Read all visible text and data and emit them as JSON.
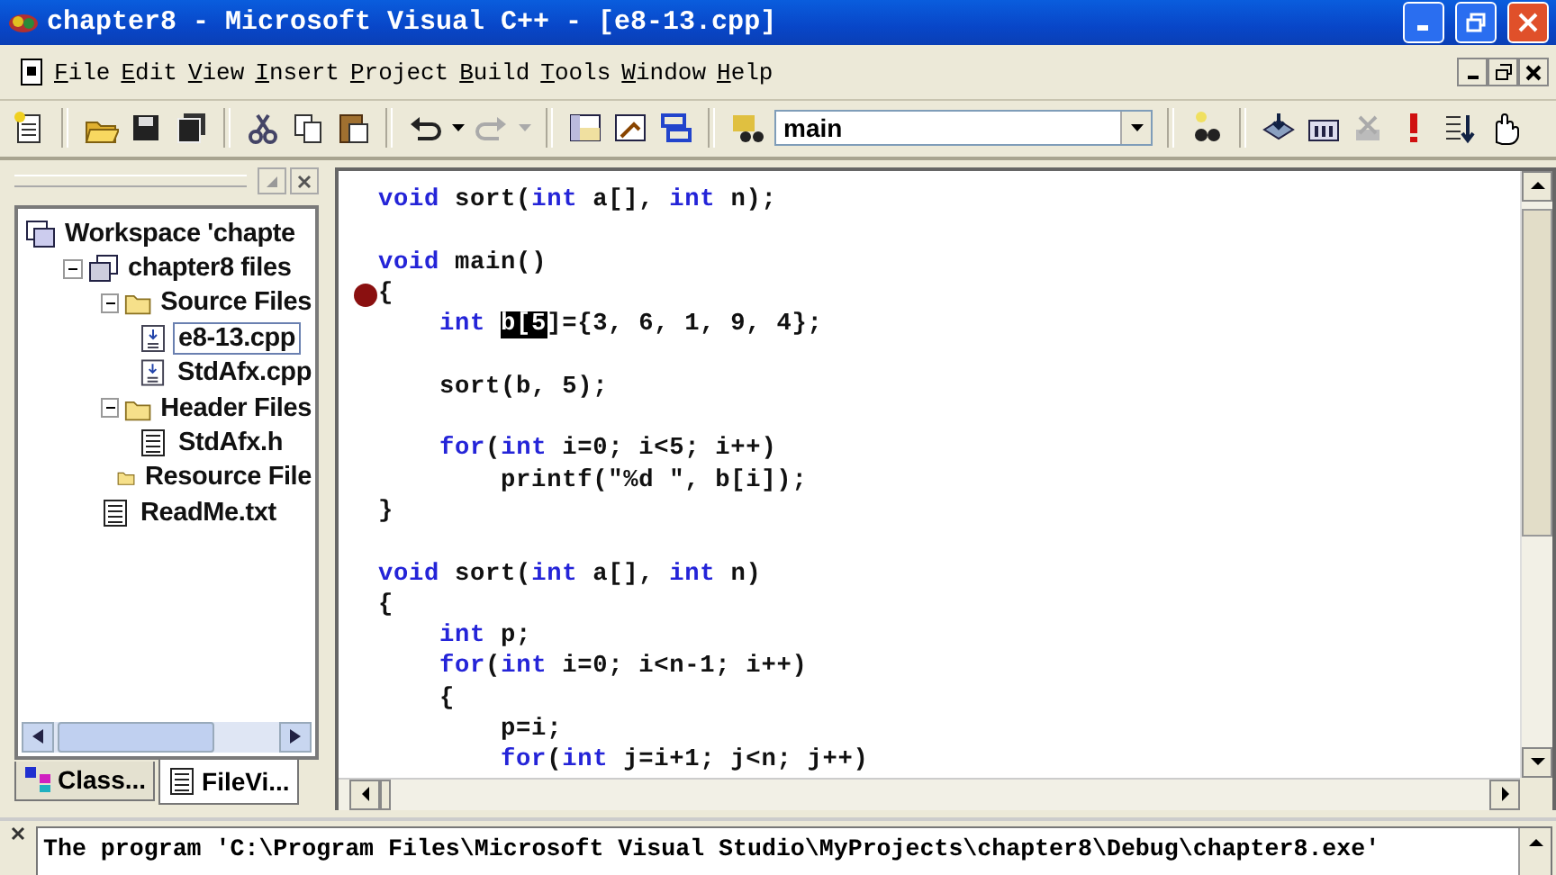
{
  "window": {
    "title": "chapter8 - Microsoft Visual C++ - [e8-13.cpp]"
  },
  "menu": [
    "File",
    "Edit",
    "View",
    "Insert",
    "Project",
    "Build",
    "Tools",
    "Window",
    "Help"
  ],
  "toolbar": {
    "combo_value": "main"
  },
  "workspace": {
    "tree": [
      {
        "label": "Workspace 'chapte",
        "kind": "workspace",
        "selected": false,
        "children": [
          {
            "label": "chapter8 files",
            "kind": "project",
            "selected": false,
            "expanded": true,
            "children": [
              {
                "label": "Source Files",
                "kind": "folder",
                "selected": false,
                "expanded": true,
                "children": [
                  {
                    "label": "e8-13.cpp",
                    "kind": "source",
                    "selected": true
                  },
                  {
                    "label": "StdAfx.cpp",
                    "kind": "source",
                    "selected": false
                  }
                ]
              },
              {
                "label": "Header Files",
                "kind": "folder",
                "selected": false,
                "expanded": true,
                "children": [
                  {
                    "label": "StdAfx.h",
                    "kind": "header",
                    "selected": false
                  }
                ]
              },
              {
                "label": "Resource File",
                "kind": "folder",
                "selected": false
              },
              {
                "label": "ReadMe.txt",
                "kind": "header",
                "selected": false
              }
            ]
          }
        ]
      }
    ],
    "tabs": [
      {
        "label": "Class...",
        "kind": "class",
        "selected": false
      },
      {
        "label": "FileVi...",
        "kind": "file",
        "selected": true
      }
    ]
  },
  "editor": {
    "lines": [
      {
        "breakpoint": false,
        "tokens": [
          {
            "kind": "keyword",
            "text": "void"
          },
          {
            "kind": "plain",
            "text": " sort("
          },
          {
            "kind": "keyword",
            "text": "int"
          },
          {
            "kind": "plain",
            "text": " a[], "
          },
          {
            "kind": "keyword",
            "text": "int"
          },
          {
            "kind": "plain",
            "text": " n);"
          }
        ]
      },
      {
        "breakpoint": false
      },
      {
        "breakpoint": false,
        "tokens": [
          {
            "kind": "keyword",
            "text": "void"
          },
          {
            "kind": "plain",
            "text": " main()"
          }
        ]
      },
      {
        "breakpoint": true,
        "tokens": [
          {
            "kind": "plain",
            "text": "{"
          }
        ]
      },
      {
        "breakpoint": false,
        "tokens": [
          {
            "kind": "keyword",
            "text": "    int"
          },
          {
            "kind": "selected",
            "text": " b[5"
          },
          {
            "kind": "plain",
            "text": "]={3, 6, 1, 9, 4};"
          }
        ]
      },
      {
        "breakpoint": false
      },
      {
        "breakpoint": false,
        "tokens": [
          {
            "kind": "plain",
            "text": "    sort(b, 5);"
          }
        ]
      },
      {
        "breakpoint": false
      },
      {
        "breakpoint": false,
        "tokens": [
          {
            "kind": "keyword",
            "text": "    for"
          },
          {
            "kind": "plain",
            "text": "("
          },
          {
            "kind": "keyword",
            "text": "int"
          },
          {
            "kind": "plain",
            "text": " i=0; i<5; i++)"
          }
        ]
      },
      {
        "breakpoint": false,
        "tokens": [
          {
            "kind": "plain",
            "text": "        printf(\"%d \", b[i]);"
          }
        ]
      },
      {
        "breakpoint": false,
        "tokens": [
          {
            "kind": "plain",
            "text": "}"
          }
        ]
      },
      {
        "breakpoint": false
      },
      {
        "breakpoint": false,
        "tokens": [
          {
            "kind": "keyword",
            "text": "void"
          },
          {
            "kind": "plain",
            "text": " sort("
          },
          {
            "kind": "keyword",
            "text": "int"
          },
          {
            "kind": "plain",
            "text": " a[], "
          },
          {
            "kind": "keyword",
            "text": "int"
          },
          {
            "kind": "plain",
            "text": " n)"
          }
        ]
      },
      {
        "breakpoint": false,
        "tokens": [
          {
            "kind": "plain",
            "text": "{"
          }
        ]
      },
      {
        "breakpoint": false,
        "tokens": [
          {
            "kind": "keyword",
            "text": "    int"
          },
          {
            "kind": "plain",
            "text": " p;"
          }
        ]
      },
      {
        "breakpoint": false,
        "tokens": [
          {
            "kind": "keyword",
            "text": "    for"
          },
          {
            "kind": "plain",
            "text": "("
          },
          {
            "kind": "keyword",
            "text": "int"
          },
          {
            "kind": "plain",
            "text": " i=0; i<n-1; i++)"
          }
        ]
      },
      {
        "breakpoint": false,
        "tokens": [
          {
            "kind": "plain",
            "text": "    {"
          }
        ]
      },
      {
        "breakpoint": false,
        "tokens": [
          {
            "kind": "plain",
            "text": "        p=i;"
          }
        ]
      },
      {
        "breakpoint": false,
        "tokens": [
          {
            "kind": "keyword",
            "text": "        for"
          },
          {
            "kind": "plain",
            "text": "("
          },
          {
            "kind": "keyword",
            "text": "int"
          },
          {
            "kind": "plain",
            "text": " j=i+1; j<n; j++)"
          }
        ]
      }
    ]
  },
  "output": {
    "text": "The program 'C:\\Program Files\\Microsoft Visual Studio\\MyProjects\\chapter8\\Debug\\chapter8.exe'"
  }
}
